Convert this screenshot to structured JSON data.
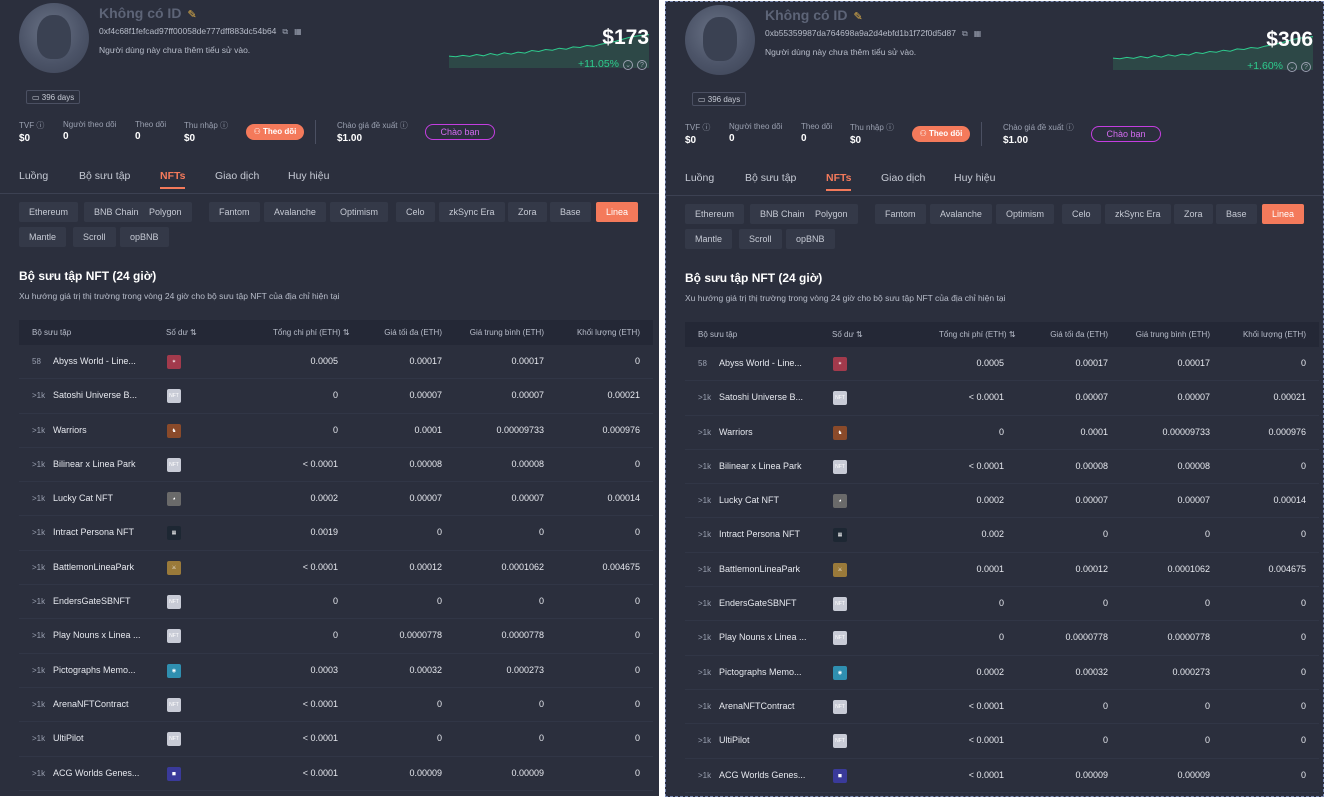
{
  "panels": [
    {
      "profile": {
        "name": "Không có ID",
        "address": "0xf4c68f1fefcad97ff00058de777dff883dc54b64",
        "bio": "Người dùng này chưa thêm tiểu sử vào.",
        "balance": "$173",
        "change": "+11.05%",
        "days": "396 days"
      },
      "stats": [
        {
          "label": "TVF",
          "value": "$0"
        },
        {
          "label": "Người theo dõi",
          "value": "0"
        },
        {
          "label": "Theo dõi",
          "value": "0"
        },
        {
          "label": "Thu nhập",
          "value": "$0"
        }
      ],
      "follow_label": "Theo dõi",
      "offer": {
        "label": "Chào giá đề xuất",
        "value": "$1.00"
      },
      "friend_label": "Chào bạn",
      "tabs": [
        "Luồng",
        "Bộ sưu tập",
        "NFTs",
        "Giao dịch",
        "Huy hiệu"
      ],
      "chains": [
        "Ethereum",
        "BNB Chain",
        "Polygon",
        "Fantom",
        "Avalanche",
        "Optimism",
        "Celo",
        "zkSync Era",
        "Zora",
        "Base",
        "Linea",
        "Mantle",
        "Scroll",
        "opBNB"
      ],
      "section_title": "Bộ sưu tập NFT (24 giờ)",
      "section_desc": "Xu hướng giá trị thị trường trong vòng 24 giờ cho bộ sưu tập NFT của địa chỉ hiện tại",
      "columns": [
        "Bộ sưu tập",
        "Số dư",
        "Tổng chi phí (ETH)",
        "Giá tối đa (ETH)",
        "Giá trung bình (ETH)",
        "Khối lượng (ETH)"
      ],
      "rows": [
        {
          "qty": "58",
          "name": "Abyss World - Line...",
          "cost": "0.0005",
          "max": "0.00017",
          "avg": "0.00017",
          "vol": "0"
        },
        {
          "qty": ">1k",
          "name": "Satoshi Universe B...",
          "cost": "0",
          "max": "0.00007",
          "avg": "0.00007",
          "vol": "0.00021"
        },
        {
          "qty": ">1k",
          "name": "Warriors",
          "cost": "0",
          "max": "0.0001",
          "avg": "0.00009733",
          "vol": "0.000976"
        },
        {
          "qty": ">1k",
          "name": "Bilinear x Linea Park",
          "cost": "< 0.0001",
          "max": "0.00008",
          "avg": "0.00008",
          "vol": "0"
        },
        {
          "qty": ">1k",
          "name": "Lucky Cat NFT",
          "cost": "0.0002",
          "max": "0.00007",
          "avg": "0.00007",
          "vol": "0.00014"
        },
        {
          "qty": ">1k",
          "name": "Intract Persona NFT",
          "cost": "0.0019",
          "max": "0",
          "avg": "0",
          "vol": "0"
        },
        {
          "qty": ">1k",
          "name": "BattlemonLineaPark",
          "cost": "< 0.0001",
          "max": "0.00012",
          "avg": "0.0001062",
          "vol": "0.004675"
        },
        {
          "qty": ">1k",
          "name": "EndersGateSBNFT",
          "cost": "0",
          "max": "0",
          "avg": "0",
          "vol": "0"
        },
        {
          "qty": ">1k",
          "name": "Play Nouns x Linea ...",
          "cost": "0",
          "max": "0.0000778",
          "avg": "0.0000778",
          "vol": "0"
        },
        {
          "qty": ">1k",
          "name": "Pictographs Memo...",
          "cost": "0.0003",
          "max": "0.00032",
          "avg": "0.000273",
          "vol": "0"
        },
        {
          "qty": ">1k",
          "name": "ArenaNFTContract",
          "cost": "< 0.0001",
          "max": "0",
          "avg": "0",
          "vol": "0"
        },
        {
          "qty": ">1k",
          "name": "UltiPilot",
          "cost": "< 0.0001",
          "max": "0",
          "avg": "0",
          "vol": "0"
        },
        {
          "qty": ">1k",
          "name": "ACG Worlds Genes...",
          "cost": "< 0.0001",
          "max": "0.00009",
          "avg": "0.00009",
          "vol": "0"
        }
      ]
    },
    {
      "profile": {
        "name": "Không có ID",
        "address": "0xb55359987da764698a9a2d4ebfd1b1f72f0d5d87",
        "bio": "Người dùng này chưa thêm tiểu sử vào.",
        "balance": "$306",
        "change": "+1.60%",
        "days": "396 days"
      },
      "stats": [
        {
          "label": "TVF",
          "value": "$0"
        },
        {
          "label": "Người theo dõi",
          "value": "0"
        },
        {
          "label": "Theo dõi",
          "value": "0"
        },
        {
          "label": "Thu nhập",
          "value": "$0"
        }
      ],
      "follow_label": "Theo dõi",
      "offer": {
        "label": "Chào giá đề xuất",
        "value": "$1.00"
      },
      "friend_label": "Chào bạn",
      "tabs": [
        "Luồng",
        "Bộ sưu tập",
        "NFTs",
        "Giao dịch",
        "Huy hiệu"
      ],
      "chains": [
        "Ethereum",
        "BNB Chain",
        "Polygon",
        "Fantom",
        "Avalanche",
        "Optimism",
        "Celo",
        "zkSync Era",
        "Zora",
        "Base",
        "Linea",
        "Mantle",
        "Scroll",
        "opBNB"
      ],
      "section_title": "Bộ sưu tập NFT (24 giờ)",
      "section_desc": "Xu hướng giá trị thị trường trong vòng 24 giờ cho bộ sưu tập NFT của địa chỉ hiện tại",
      "columns": [
        "Bộ sưu tập",
        "Số dư",
        "Tổng chi phí (ETH)",
        "Giá tối đa (ETH)",
        "Giá trung bình (ETH)",
        "Khối lượng (ETH)"
      ],
      "rows": [
        {
          "qty": "58",
          "name": "Abyss World - Line...",
          "cost": "0.0005",
          "max": "0.00017",
          "avg": "0.00017",
          "vol": "0"
        },
        {
          "qty": ">1k",
          "name": "Satoshi Universe B...",
          "cost": "< 0.0001",
          "max": "0.00007",
          "avg": "0.00007",
          "vol": "0.00021"
        },
        {
          "qty": ">1k",
          "name": "Warriors",
          "cost": "0",
          "max": "0.0001",
          "avg": "0.00009733",
          "vol": "0.000976"
        },
        {
          "qty": ">1k",
          "name": "Bilinear x Linea Park",
          "cost": "< 0.0001",
          "max": "0.00008",
          "avg": "0.00008",
          "vol": "0"
        },
        {
          "qty": ">1k",
          "name": "Lucky Cat NFT",
          "cost": "0.0002",
          "max": "0.00007",
          "avg": "0.00007",
          "vol": "0.00014"
        },
        {
          "qty": ">1k",
          "name": "Intract Persona NFT",
          "cost": "0.002",
          "max": "0",
          "avg": "0",
          "vol": "0"
        },
        {
          "qty": ">1k",
          "name": "BattlemonLineaPark",
          "cost": "0.0001",
          "max": "0.00012",
          "avg": "0.0001062",
          "vol": "0.004675"
        },
        {
          "qty": ">1k",
          "name": "EndersGateSBNFT",
          "cost": "0",
          "max": "0",
          "avg": "0",
          "vol": "0"
        },
        {
          "qty": ">1k",
          "name": "Play Nouns x Linea ...",
          "cost": "0",
          "max": "0.0000778",
          "avg": "0.0000778",
          "vol": "0"
        },
        {
          "qty": ">1k",
          "name": "Pictographs Memo...",
          "cost": "0.0002",
          "max": "0.00032",
          "avg": "0.000273",
          "vol": "0"
        },
        {
          "qty": ">1k",
          "name": "ArenaNFTContract",
          "cost": "< 0.0001",
          "max": "0",
          "avg": "0",
          "vol": "0"
        },
        {
          "qty": ">1k",
          "name": "UltiPilot",
          "cost": "< 0.0001",
          "max": "0",
          "avg": "0",
          "vol": "0"
        },
        {
          "qty": ">1k",
          "name": "ACG Worlds Genes...",
          "cost": "< 0.0001",
          "max": "0.00009",
          "avg": "0.00009",
          "vol": "0"
        }
      ]
    }
  ],
  "active_tab": "NFTs",
  "active_chain": "Linea",
  "thumb_icons": [
    "galaxy-icon",
    "nft-badge-icon",
    "warrior-icon",
    "nft-badge-icon",
    "cat-icon",
    "pixel-persona-icon",
    "battlemon-icon",
    "nft-badge-icon",
    "nft-badge-icon",
    "globe-icon",
    "nft-badge-icon",
    "nft-badge-icon",
    "acg-icon"
  ],
  "colors": {
    "accent": "#f47a5b",
    "positive": "#2ecc8e",
    "friend": "#c43ee0",
    "panel": "#2b2f3d"
  }
}
